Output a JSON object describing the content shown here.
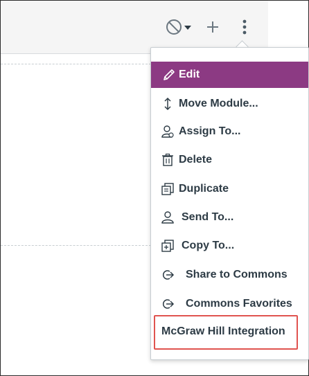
{
  "menu": {
    "items": [
      {
        "label": "Edit",
        "icon": "pencil-icon"
      },
      {
        "label": "Move Module...",
        "icon": "move-arrows-icon"
      },
      {
        "label": "Assign To...",
        "icon": "assign-user-icon"
      },
      {
        "label": "Delete",
        "icon": "trash-icon"
      },
      {
        "label": "Duplicate",
        "icon": "duplicate-icon"
      },
      {
        "label": "Send To...",
        "icon": "user-icon"
      },
      {
        "label": "Copy To...",
        "icon": "copy-to-icon"
      },
      {
        "label": "Share to Commons",
        "icon": "commons-share-icon"
      },
      {
        "label": "Commons Favorites",
        "icon": "commons-share-icon"
      },
      {
        "label": "McGraw Hill Integration",
        "icon": ""
      }
    ]
  },
  "colors": {
    "active_bg": "#8c3a83",
    "highlight_border": "#e0534f",
    "text": "#2d3b45"
  }
}
